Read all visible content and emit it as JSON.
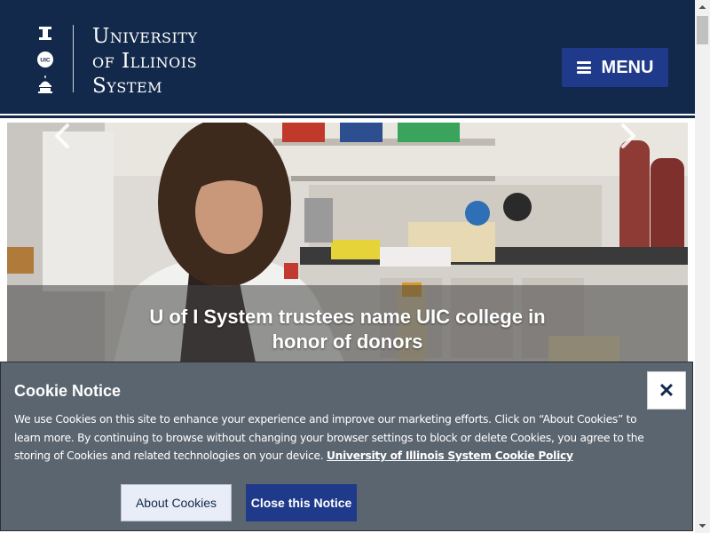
{
  "header": {
    "logo_marks": [
      "I",
      "UIC",
      "UIS"
    ],
    "wordmark_lines": [
      "University",
      "of Illinois",
      "System"
    ],
    "menu_label": "MENU",
    "background": "#13294b"
  },
  "hero": {
    "caption_line1": "U of I System trustees name UIC college in",
    "caption_line2": "honor of donors",
    "prev_icon": "chevron-left-icon",
    "next_icon": "chevron-right-icon"
  },
  "cookie_notice": {
    "title": "Cookie Notice",
    "body": "We use Cookies on this site to enhance your experience and improve our marketing efforts. Click on “About Cookies” to learn more. By continuing to browse without changing your browser settings to block or delete Cookies, you agree to the storing of Cookies and related technologies on your device.",
    "policy_link": "University of Illinois System Cookie Policy",
    "about_button": "About Cookies",
    "close_button": "Close this Notice",
    "close_icon": "✕",
    "background": "#5b6570"
  },
  "colors": {
    "navy": "#13294b",
    "button_blue": "#1f3a8a"
  }
}
